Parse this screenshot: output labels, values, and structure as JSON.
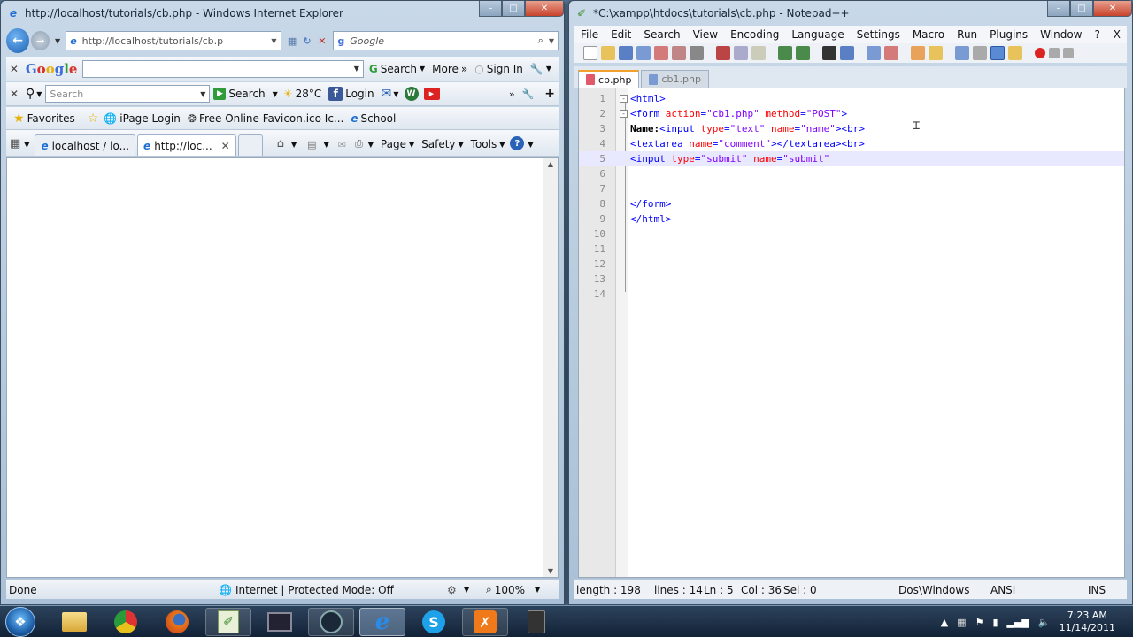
{
  "ie": {
    "title": "http://localhost/tutorials/cb.php - Windows Internet Explorer",
    "address": "http://localhost/tutorials/cb.p",
    "search_placeholder": "Google",
    "google_bar": {
      "logo_letters": [
        "G",
        "o",
        "o",
        "g",
        "l",
        "e"
      ],
      "search_label": "Search",
      "more_label": "More",
      "signin_label": "Sign In"
    },
    "toolbar2": {
      "search_placeholder": "Search",
      "search_label": "Search",
      "weather": "28°C",
      "login_label": "Login"
    },
    "favorites": {
      "label": "Favorites",
      "items": [
        "iPage Login",
        "Free Online Favicon.ico Ic...",
        "School"
      ]
    },
    "tabs": [
      {
        "label": "localhost / lo..."
      },
      {
        "label": "http://loc..."
      }
    ],
    "command": {
      "page_label": "Page",
      "safety_label": "Safety",
      "tools_label": "Tools"
    },
    "status": {
      "done": "Done",
      "zone": "Internet | Protected Mode: Off",
      "zoom": "100%"
    }
  },
  "npp": {
    "title": "*C:\\xampp\\htdocs\\tutorials\\cb.php - Notepad++",
    "menu": [
      "File",
      "Edit",
      "Search",
      "View",
      "Encoding",
      "Language",
      "Settings",
      "Macro",
      "Run",
      "Plugins",
      "Window",
      "?"
    ],
    "menu_close": "X",
    "tabs": [
      {
        "label": "cb.php",
        "active": true
      },
      {
        "label": "cb1.php",
        "active": false
      }
    ],
    "lines": [
      {
        "n": "1",
        "fold": "-",
        "tokens": [
          {
            "c": "tag",
            "t": "<html>"
          }
        ]
      },
      {
        "n": "2",
        "fold": "-",
        "tokens": [
          {
            "c": "tag",
            "t": "<form "
          },
          {
            "c": "attr",
            "t": "action"
          },
          {
            "c": "tag",
            "t": "="
          },
          {
            "c": "str",
            "t": "\"cb1.php\""
          },
          {
            "c": "tag",
            "t": " "
          },
          {
            "c": "attr",
            "t": "method"
          },
          {
            "c": "tag",
            "t": "="
          },
          {
            "c": "str",
            "t": "\"POST\""
          },
          {
            "c": "tag",
            "t": ">"
          }
        ]
      },
      {
        "n": "3",
        "fold": "",
        "tokens": [
          {
            "c": "plain",
            "t": "Name:"
          },
          {
            "c": "tag",
            "t": "<input "
          },
          {
            "c": "attr",
            "t": "type"
          },
          {
            "c": "tag",
            "t": "="
          },
          {
            "c": "str",
            "t": "\"text\""
          },
          {
            "c": "tag",
            "t": " "
          },
          {
            "c": "attr",
            "t": "name"
          },
          {
            "c": "tag",
            "t": "="
          },
          {
            "c": "str",
            "t": "\"name\""
          },
          {
            "c": "tag",
            "t": "><br>"
          }
        ]
      },
      {
        "n": "4",
        "fold": "",
        "tokens": [
          {
            "c": "tag",
            "t": "<textarea "
          },
          {
            "c": "attr",
            "t": "name"
          },
          {
            "c": "tag",
            "t": "="
          },
          {
            "c": "str",
            "t": "\"comment\""
          },
          {
            "c": "tag",
            "t": "></textarea><br>"
          }
        ]
      },
      {
        "n": "5",
        "fold": "",
        "current": true,
        "tokens": [
          {
            "c": "tag",
            "t": "<input "
          },
          {
            "c": "attr",
            "t": "type"
          },
          {
            "c": "tag",
            "t": "="
          },
          {
            "c": "str",
            "t": "\"submit\""
          },
          {
            "c": "tag",
            "t": " "
          },
          {
            "c": "attr",
            "t": "name"
          },
          {
            "c": "tag",
            "t": "="
          },
          {
            "c": "str",
            "t": "\"submit\""
          }
        ]
      },
      {
        "n": "6",
        "fold": "",
        "tokens": []
      },
      {
        "n": "7",
        "fold": "",
        "tokens": []
      },
      {
        "n": "8",
        "fold": "",
        "tokens": [
          {
            "c": "tag",
            "t": "</form>"
          }
        ]
      },
      {
        "n": "9",
        "fold": "",
        "tokens": [
          {
            "c": "tag",
            "t": "</html>"
          }
        ]
      },
      {
        "n": "10",
        "fold": "",
        "tokens": []
      },
      {
        "n": "11",
        "fold": "",
        "tokens": []
      },
      {
        "n": "12",
        "fold": "",
        "tokens": []
      },
      {
        "n": "13",
        "fold": "",
        "tokens": []
      },
      {
        "n": "14",
        "fold": "",
        "tokens": []
      }
    ],
    "status": {
      "length": "length : 198",
      "lines": "lines : 14",
      "ln": "Ln : 5",
      "col": "Col : 36",
      "sel": "Sel : 0",
      "eol": "Dos\\Windows",
      "encoding": "ANSI",
      "mode": "INS"
    }
  },
  "taskbar": {
    "time": "7:23 AM",
    "date": "11/14/2011"
  },
  "colors": {
    "tag": "#0000ff",
    "attr": "#ff0000",
    "string": "#8000ff",
    "current_line": "#e8e8ff"
  }
}
